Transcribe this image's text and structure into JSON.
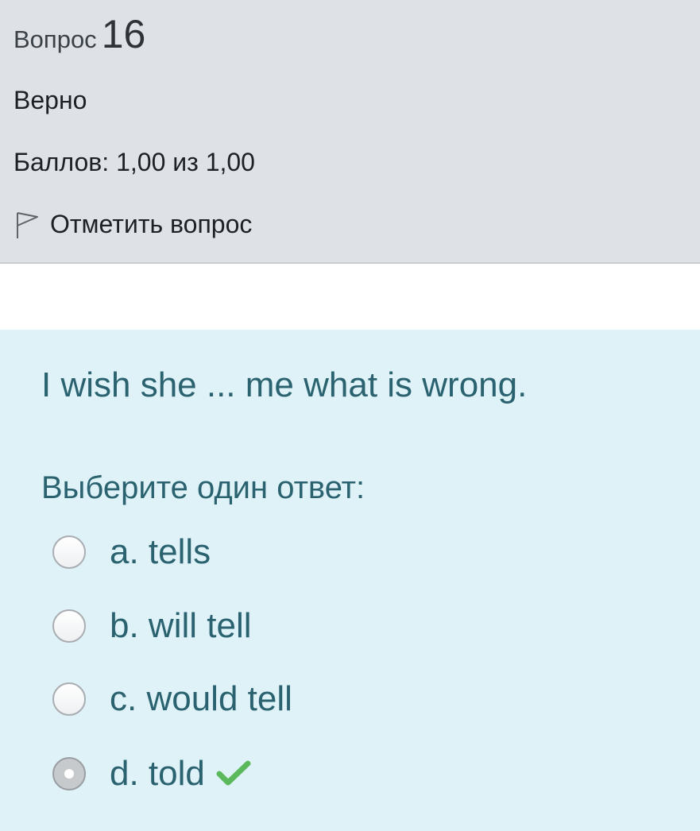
{
  "question_info": {
    "label": "Вопрос",
    "number": "16",
    "state": "Верно",
    "grade": "Баллов: 1,00 из 1,00",
    "flag_label": "Отметить вопрос",
    "flag_icon": "flag-icon"
  },
  "formulation": {
    "question_text": "I wish she ... me what is wrong.",
    "prompt": "Выберите один ответ:",
    "options": [
      {
        "label": "a. tells",
        "selected": false
      },
      {
        "label": "b. will tell",
        "selected": false
      },
      {
        "label": "c. would tell",
        "selected": false
      },
      {
        "label": "d. told",
        "selected": true,
        "correct_icon": "checkmark-icon"
      }
    ]
  },
  "colors": {
    "info_background": "#dee2e6",
    "formulation_background": "#def2f8",
    "text_accent": "#2a6270",
    "correct_check": "#5cb85c"
  }
}
